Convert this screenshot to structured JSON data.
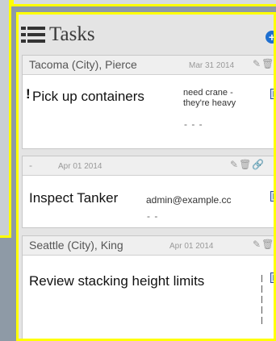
{
  "panel": {
    "title": "Tasks"
  },
  "icons": {
    "list": "list-icon",
    "add": "plus-circle-icon",
    "edit": "edit-icon",
    "delete": "trash-icon",
    "link": "link-icon",
    "checkbox": "checkbox-icon"
  },
  "colors": {
    "highlight": "#ffff00",
    "accent": "#1e6fd0",
    "checkbox": "#2a55b5"
  },
  "tasks": [
    {
      "location": "Tacoma (City), Pierce",
      "date": "Mar 31 2014",
      "title": "Pick up containers",
      "priority": "!",
      "note": "need crane - they're heavy",
      "more": "- - -"
    },
    {
      "location": "-",
      "date": "Apr 01 2014",
      "title": "Inspect Tanker",
      "assignee": "admin@example.cc",
      "more": "- -"
    },
    {
      "location": "Seattle (City), King",
      "date": "Apr 01 2014",
      "title": "Review stacking height limits"
    }
  ]
}
